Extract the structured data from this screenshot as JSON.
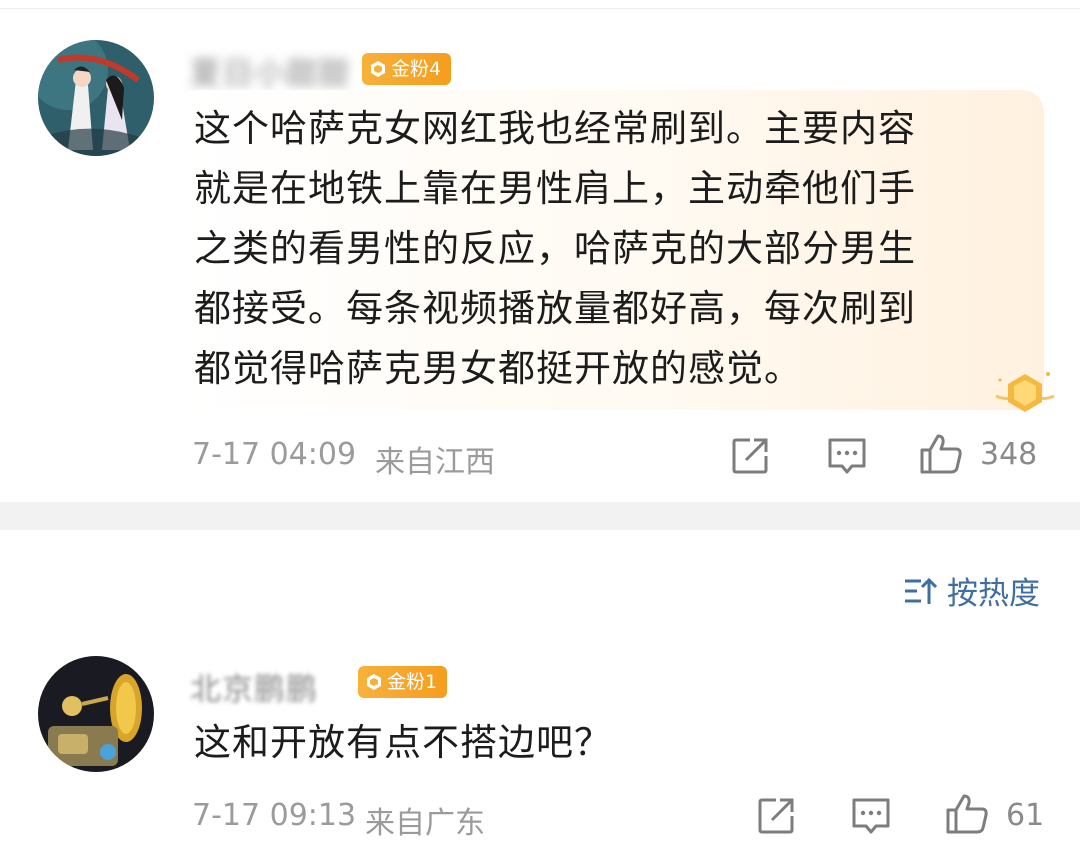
{
  "comments": [
    {
      "username": "夏日小甜甜",
      "badge": "金粉4",
      "text_lines": [
        "这个哈萨克女网红我也经常刷到。主要内容",
        "就是在地铁上靠在男性肩上，主动牵他们手",
        "之类的看男性的反应，哈萨克的大部分男生",
        "都接受。每条视频播放量都好高，每次刷到",
        "都觉得哈萨克男女都挺开放的感觉。"
      ],
      "time": "7-17 04:09",
      "location": "来自江西",
      "likes": "348",
      "icons": {
        "share": "share-icon",
        "comment": "comment-icon",
        "like": "thumbs-up-icon"
      }
    },
    {
      "username": "北京鹏鹏",
      "badge": "金粉1",
      "text_lines": [
        "这和开放有点不搭边吧？"
      ],
      "time": "7-17 09:13",
      "location": "来自广东",
      "likes": "61",
      "icons": {
        "share": "share-icon",
        "comment": "comment-icon",
        "like": "thumbs-up-icon"
      }
    }
  ],
  "sort": {
    "label": "按热度",
    "icon": "sort-icon"
  },
  "colors": {
    "badge": "#f5a623",
    "sort_link": "#3f6ea3",
    "meta": "#9b9b9b",
    "divider": "#f2f2f2"
  }
}
